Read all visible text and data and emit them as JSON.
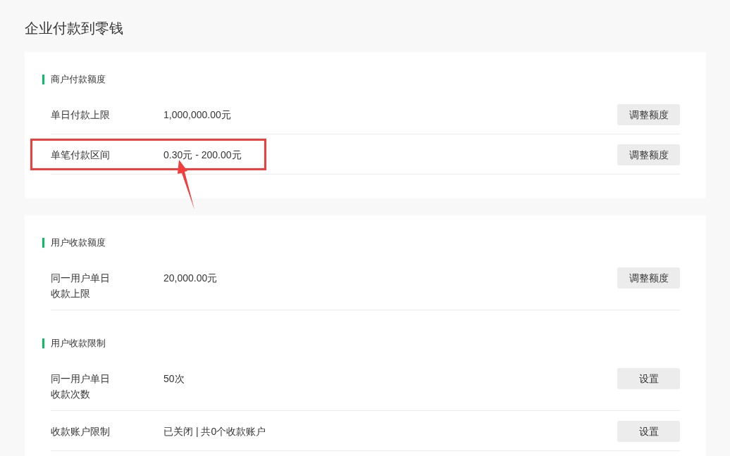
{
  "title": "企业付款到零钱",
  "cards": [
    {
      "sections": [
        {
          "heading": "商户付款额度",
          "rows": [
            {
              "label": "单日付款上限",
              "value": "1,000,000.00元",
              "button": "调整额度",
              "highlighted": false
            },
            {
              "label": "单笔付款区间",
              "value": "0.30元 - 200.00元",
              "button": "调整额度",
              "highlighted": true
            }
          ]
        }
      ]
    },
    {
      "sections": [
        {
          "heading": "用户收款额度",
          "rows": [
            {
              "label": "同一用户单日收款上限",
              "value": "20,000.00元",
              "button": "调整额度",
              "highlighted": false
            }
          ]
        },
        {
          "heading": "用户收款限制",
          "rows": [
            {
              "label": "同一用户单日收款次数",
              "value": "50次",
              "button": "设置",
              "highlighted": false
            },
            {
              "label": "收款账户限制",
              "value": "已关闭 | 共0个收款账户",
              "button": "设置",
              "highlighted": false
            }
          ]
        }
      ]
    }
  ]
}
